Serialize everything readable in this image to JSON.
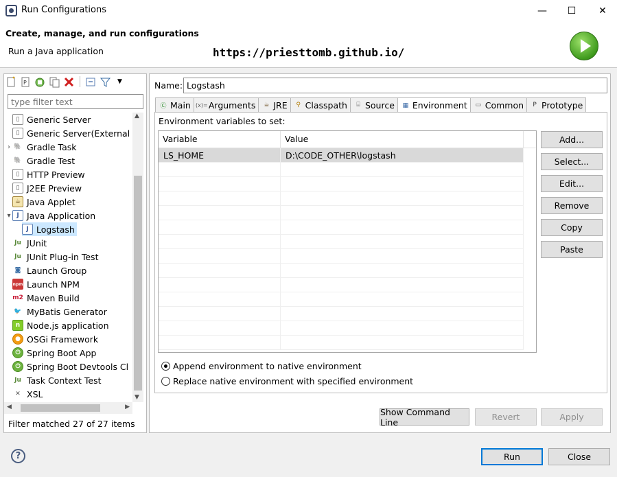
{
  "window": {
    "title": "Run Configurations",
    "controls": [
      "—",
      "☐",
      "✕"
    ]
  },
  "header": {
    "title": "Create, manage, and run configurations",
    "subtitle": "Run a Java application",
    "watermark": "https://priesttomb.github.io/"
  },
  "left": {
    "filter_placeholder": "type filter text",
    "status": "Filter matched 27 of 27 items",
    "items": [
      {
        "label": "Generic Server",
        "icon": "server-icon",
        "indent": 1,
        "twisty": ""
      },
      {
        "label": "Generic Server(External",
        "icon": "server-icon",
        "indent": 1,
        "twisty": ""
      },
      {
        "label": "Gradle Task",
        "icon": "gradle-icon",
        "indent": 1,
        "twisty": "›"
      },
      {
        "label": "Gradle Test",
        "icon": "gradle-icon",
        "indent": 1,
        "twisty": ""
      },
      {
        "label": "HTTP Preview",
        "icon": "server-icon",
        "indent": 1,
        "twisty": ""
      },
      {
        "label": "J2EE Preview",
        "icon": "server-icon",
        "indent": 1,
        "twisty": ""
      },
      {
        "label": "Java Applet",
        "icon": "applet-icon",
        "indent": 1,
        "twisty": ""
      },
      {
        "label": "Java Application",
        "icon": "java-app-icon",
        "indent": 1,
        "twisty": "⌄"
      },
      {
        "label": "Logstash",
        "icon": "java-app-icon",
        "indent": 2,
        "twisty": "",
        "selected": true
      },
      {
        "label": "JUnit",
        "icon": "junit-icon",
        "indent": 1,
        "twisty": ""
      },
      {
        "label": "JUnit Plug-in Test",
        "icon": "junit-icon",
        "indent": 1,
        "twisty": ""
      },
      {
        "label": "Launch Group",
        "icon": "launch-group-icon",
        "indent": 1,
        "twisty": ""
      },
      {
        "label": "Launch NPM",
        "icon": "npm-icon",
        "indent": 1,
        "twisty": ""
      },
      {
        "label": "Maven Build",
        "icon": "maven-icon",
        "indent": 1,
        "twisty": ""
      },
      {
        "label": "MyBatis Generator",
        "icon": "mybatis-icon",
        "indent": 1,
        "twisty": ""
      },
      {
        "label": "Node.js application",
        "icon": "nodejs-icon",
        "indent": 1,
        "twisty": ""
      },
      {
        "label": "OSGi Framework",
        "icon": "osgi-icon",
        "indent": 1,
        "twisty": ""
      },
      {
        "label": "Spring Boot App",
        "icon": "spring-icon",
        "indent": 1,
        "twisty": ""
      },
      {
        "label": "Spring Boot Devtools Cl",
        "icon": "spring-icon",
        "indent": 1,
        "twisty": ""
      },
      {
        "label": "Task Context Test",
        "icon": "junit-icon",
        "indent": 1,
        "twisty": ""
      },
      {
        "label": "XSL",
        "icon": "xsl-icon",
        "indent": 1,
        "twisty": ""
      }
    ]
  },
  "right": {
    "name_label": "Name:",
    "name_value": "Logstash",
    "tabs": [
      {
        "label": "Main",
        "icon": "main-tab-icon",
        "glyph": "Ⓒ",
        "color": "#2f8f2f"
      },
      {
        "label": "Arguments",
        "icon": "arguments-icon",
        "glyph": "(x)=",
        "color": "#555"
      },
      {
        "label": "JRE",
        "icon": "jre-icon",
        "glyph": "☕",
        "color": "#6a4a1c"
      },
      {
        "label": "Classpath",
        "icon": "classpath-icon",
        "glyph": "⚲",
        "color": "#b07a00"
      },
      {
        "label": "Source",
        "icon": "source-icon",
        "glyph": "⌸",
        "color": "#6a6a6a"
      },
      {
        "label": "Environment",
        "icon": "environment-icon",
        "glyph": "▦",
        "color": "#3465a4",
        "active": true
      },
      {
        "label": "Common",
        "icon": "common-icon",
        "glyph": "▭",
        "color": "#555"
      },
      {
        "label": "Prototype",
        "icon": "prototype-icon",
        "glyph": "P",
        "color": "#333"
      }
    ],
    "env_label": "Environment variables to set:",
    "columns": [
      "Variable",
      "Value"
    ],
    "rows": [
      {
        "variable": "LS_HOME",
        "value": "D:\\CODE_OTHER\\logstash"
      }
    ],
    "side_buttons": [
      "Add...",
      "Select...",
      "Edit...",
      "Remove",
      "Copy",
      "Paste"
    ],
    "radio_append": "Append environment to native environment",
    "radio_replace": "Replace native environment with specified environment",
    "show_cmd": "Show Command Line",
    "revert": "Revert",
    "apply": "Apply"
  },
  "footer": {
    "run": "Run",
    "close": "Close"
  }
}
